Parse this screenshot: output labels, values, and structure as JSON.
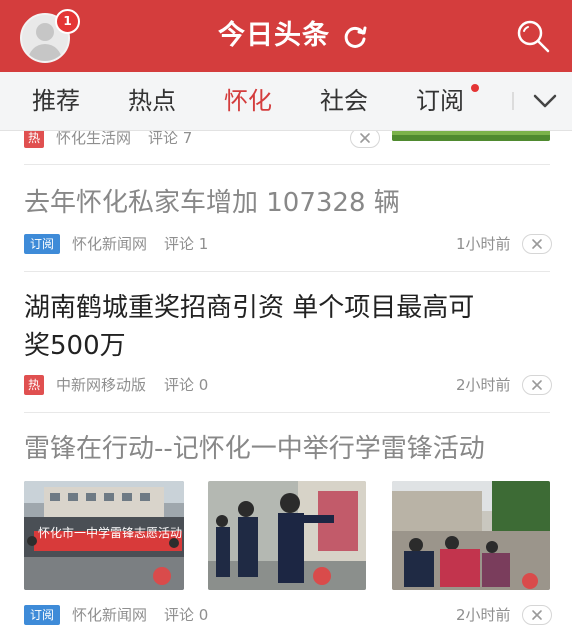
{
  "header": {
    "title": "今日头条",
    "notification_count": "1",
    "brand_color": "#d43d3d",
    "icons": [
      "avatar",
      "refresh-icon",
      "search-icon"
    ]
  },
  "tabs": [
    {
      "label": "推荐",
      "active": false
    },
    {
      "label": "热点",
      "active": false
    },
    {
      "label": "怀化",
      "active": true
    },
    {
      "label": "社会",
      "active": false
    },
    {
      "label": "订阅",
      "active": false,
      "has_dot": true
    }
  ],
  "feed": [
    {
      "title": "",
      "tag": "热",
      "source": "怀化生活网",
      "comments": "评论 7",
      "time": ""
    },
    {
      "title": "去年怀化私家车增加 107328 辆",
      "tag": "订阅",
      "source": "怀化新闻网",
      "comments": "评论 1",
      "time": "1小时前"
    },
    {
      "title_line1": "湖南鹤城重奖招商引资 单个项目最高可",
      "title_line2": "奖500万",
      "tag": "热",
      "source": "中新网移动版",
      "comments": "评论 0",
      "time": "2小时前"
    },
    {
      "title": "雷锋在行动--记怀化一中举行学雷锋活动",
      "banner_text": "怀化市一中学雷锋志愿活动",
      "tag": "订阅",
      "source": "怀化新闻网",
      "comments": "评论 0",
      "time": "2小时前"
    }
  ]
}
